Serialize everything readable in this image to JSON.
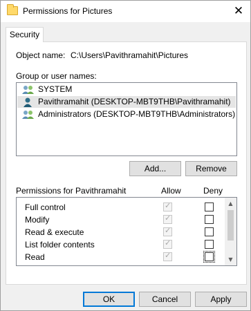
{
  "window": {
    "title": "Permissions for Pictures",
    "close_glyph": "✕"
  },
  "tab": {
    "label": "Security"
  },
  "object": {
    "label": "Object name:",
    "value": "C:\\Users\\Pavithramahit\\Pictures"
  },
  "groups": {
    "label": "Group or user names:",
    "items": [
      {
        "name": "SYSTEM",
        "icon": "group-icon",
        "selected": false
      },
      {
        "name": "Pavithramahit (DESKTOP-MBT9THB\\Pavithramahit)",
        "icon": "user-icon",
        "selected": true
      },
      {
        "name": "Administrators (DESKTOP-MBT9THB\\Administrators)",
        "icon": "group-icon",
        "selected": false
      }
    ]
  },
  "buttons": {
    "add": "Add...",
    "remove": "Remove",
    "ok": "OK",
    "cancel": "Cancel",
    "apply": "Apply"
  },
  "permissions": {
    "label": "Permissions for Pavithramahit",
    "allow_header": "Allow",
    "deny_header": "Deny",
    "rows": [
      {
        "name": "Full control",
        "allow": true,
        "deny": false
      },
      {
        "name": "Modify",
        "allow": true,
        "deny": false
      },
      {
        "name": "Read & execute",
        "allow": true,
        "deny": false
      },
      {
        "name": "List folder contents",
        "allow": true,
        "deny": false
      },
      {
        "name": "Read",
        "allow": true,
        "deny": false
      }
    ]
  },
  "colors": {
    "accent": "#0078d7",
    "selection": "#e5e5e5"
  }
}
